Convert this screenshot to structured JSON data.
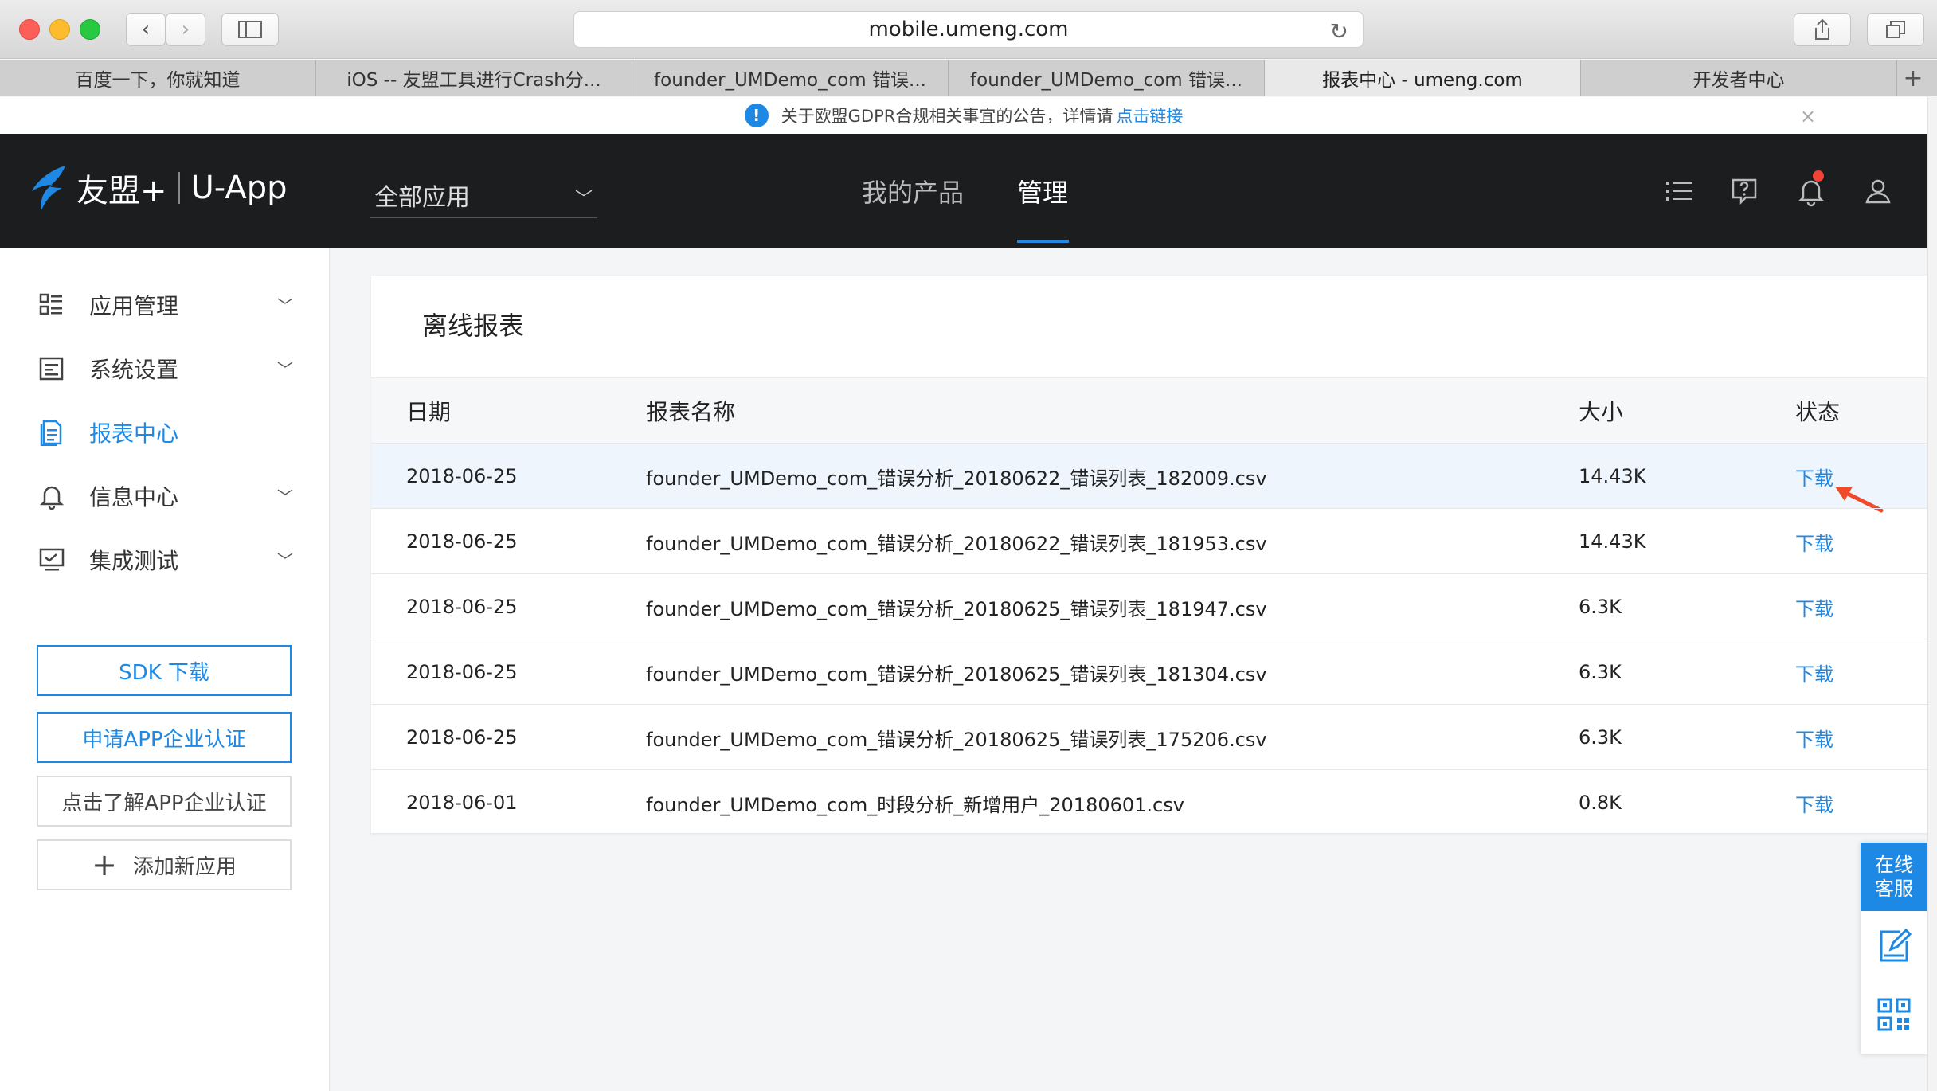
{
  "browser": {
    "url": "mobile.umeng.com",
    "tabs": [
      {
        "label": "百度一下，你就知道",
        "active": false
      },
      {
        "label": "iOS -- 友盟工具进行Crash分...",
        "active": false
      },
      {
        "label": "founder_UMDemo_com 错误...",
        "active": false
      },
      {
        "label": "founder_UMDemo_com 错误...",
        "active": false
      },
      {
        "label": "报表中心 - umeng.com",
        "active": true
      },
      {
        "label": "开发者中心",
        "active": false
      }
    ],
    "new_tab_symbol": "+"
  },
  "notice": {
    "text": "关于欧盟GDPR合规相关事宜的公告，详情请",
    "link": "点击链接",
    "close": "×"
  },
  "header": {
    "brand": "友盟+",
    "product": "U-App",
    "app_select": "全部应用",
    "nav": [
      {
        "label": "我的产品",
        "active": false
      },
      {
        "label": "管理",
        "active": true
      }
    ]
  },
  "sidebar": {
    "items": [
      {
        "label": "应用管理",
        "icon": "app-grid-icon",
        "active": false,
        "expandable": true
      },
      {
        "label": "系统设置",
        "icon": "settings-panel-icon",
        "active": false,
        "expandable": true
      },
      {
        "label": "报表中心",
        "icon": "report-doc-icon",
        "active": true,
        "expandable": false
      },
      {
        "label": "信息中心",
        "icon": "bell-icon",
        "active": false,
        "expandable": true
      },
      {
        "label": "集成测试",
        "icon": "monitor-check-icon",
        "active": false,
        "expandable": true
      }
    ],
    "buttons": {
      "sdk": "SDK 下载",
      "apply_cert": "申请APP企业认证",
      "learn_cert": "点击了解APP企业认证",
      "add_app": "添加新应用"
    }
  },
  "report": {
    "title": "离线报表",
    "columns": {
      "date": "日期",
      "name": "报表名称",
      "size": "大小",
      "status": "状态"
    },
    "rows": [
      {
        "date": "2018-06-25",
        "name": "founder_UMDemo_com_错误分析_20180622_错误列表_182009.csv",
        "size": "14.43K",
        "status": "下载"
      },
      {
        "date": "2018-06-25",
        "name": "founder_UMDemo_com_错误分析_20180622_错误列表_181953.csv",
        "size": "14.43K",
        "status": "下载"
      },
      {
        "date": "2018-06-25",
        "name": "founder_UMDemo_com_错误分析_20180625_错误列表_181947.csv",
        "size": "6.3K",
        "status": "下载"
      },
      {
        "date": "2018-06-25",
        "name": "founder_UMDemo_com_错误分析_20180625_错误列表_181304.csv",
        "size": "6.3K",
        "status": "下载"
      },
      {
        "date": "2018-06-25",
        "name": "founder_UMDemo_com_错误分析_20180625_错误列表_175206.csv",
        "size": "6.3K",
        "status": "下载"
      },
      {
        "date": "2018-06-01",
        "name": "founder_UMDemo_com_时段分析_新增用户_20180601.csv",
        "size": "0.8K",
        "status": "下载"
      }
    ]
  },
  "float": {
    "chat": "在线客服"
  },
  "colors": {
    "accent": "#1e88e5",
    "header_bg": "#1c1d1f",
    "arrow": "#f04a2a"
  }
}
